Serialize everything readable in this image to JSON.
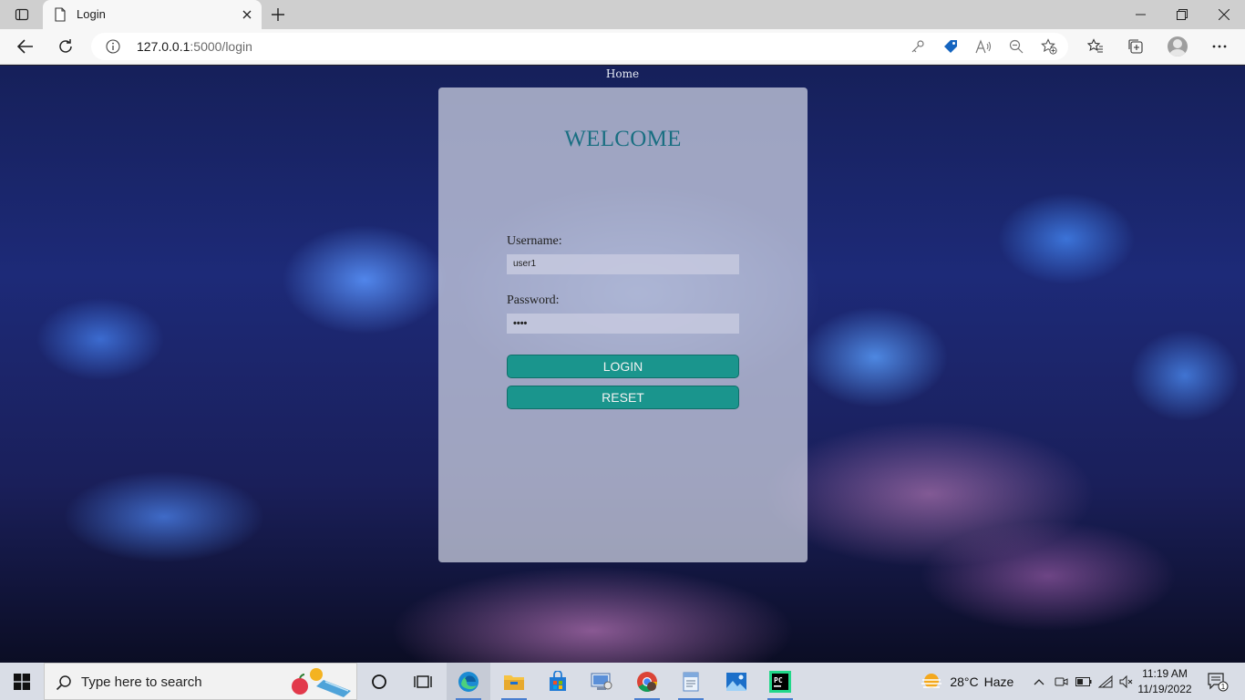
{
  "browser": {
    "tab_title": "Login",
    "url_host": "127.0.0.1",
    "url_path": ":5000/login"
  },
  "page": {
    "nav_home": "Home",
    "welcome": "WELCOME",
    "username_label": "Username:",
    "username_value": "user1",
    "password_label": "Password:",
    "password_value": "••••",
    "login_button": "LOGIN",
    "reset_button": "RESET"
  },
  "taskbar": {
    "search_placeholder": "Type here to search",
    "weather_temp": "28°C",
    "weather_desc": "Haze",
    "time": "11:19 AM",
    "date": "11/19/2022",
    "notification_count": "1"
  },
  "colors": {
    "accent_teal": "#1a958d",
    "title_teal": "#1a6f82"
  }
}
